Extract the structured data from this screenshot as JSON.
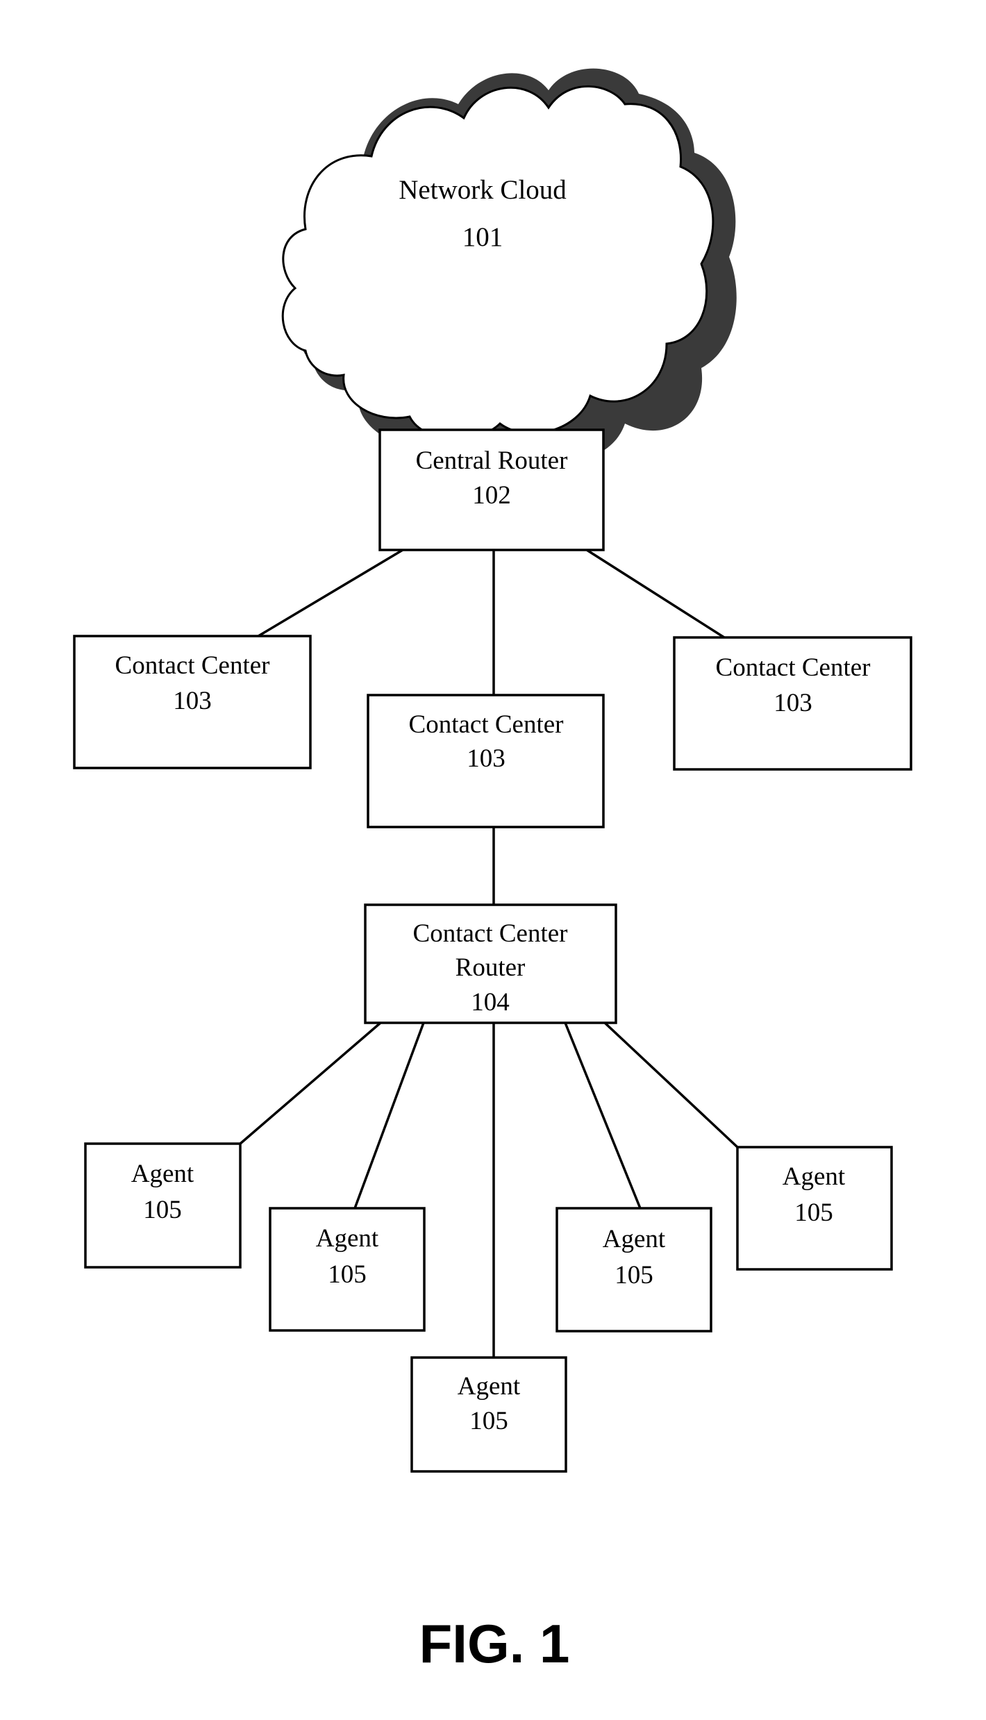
{
  "figure": {
    "label": "FIG. 1"
  },
  "nodes": {
    "network_cloud": {
      "lines": [
        "Network Cloud",
        "101"
      ]
    },
    "central_router": {
      "lines": [
        "Central Router",
        "102"
      ]
    },
    "contact_center_left": {
      "lines": [
        "Contact Center",
        "103"
      ]
    },
    "contact_center_middle": {
      "lines": [
        "Contact Center",
        "103"
      ]
    },
    "contact_center_right": {
      "lines": [
        "Contact Center",
        "103"
      ]
    },
    "contact_center_router": {
      "lines": [
        "Contact Center",
        "Router",
        "104"
      ]
    },
    "agent_1": {
      "lines": [
        "Agent",
        "105"
      ]
    },
    "agent_2": {
      "lines": [
        "Agent",
        "105"
      ]
    },
    "agent_3": {
      "lines": [
        "Agent",
        "105"
      ]
    },
    "agent_4": {
      "lines": [
        "Agent",
        "105"
      ]
    },
    "agent_5": {
      "lines": [
        "Agent",
        "105"
      ]
    }
  },
  "edges": [
    [
      "network_cloud",
      "central_router"
    ],
    [
      "central_router",
      "contact_center_left"
    ],
    [
      "central_router",
      "contact_center_middle"
    ],
    [
      "central_router",
      "contact_center_right"
    ],
    [
      "contact_center_middle",
      "contact_center_router"
    ],
    [
      "contact_center_router",
      "agent_1"
    ],
    [
      "contact_center_router",
      "agent_2"
    ],
    [
      "contact_center_router",
      "agent_3"
    ],
    [
      "contact_center_router",
      "agent_4"
    ],
    [
      "contact_center_router",
      "agent_5"
    ]
  ]
}
